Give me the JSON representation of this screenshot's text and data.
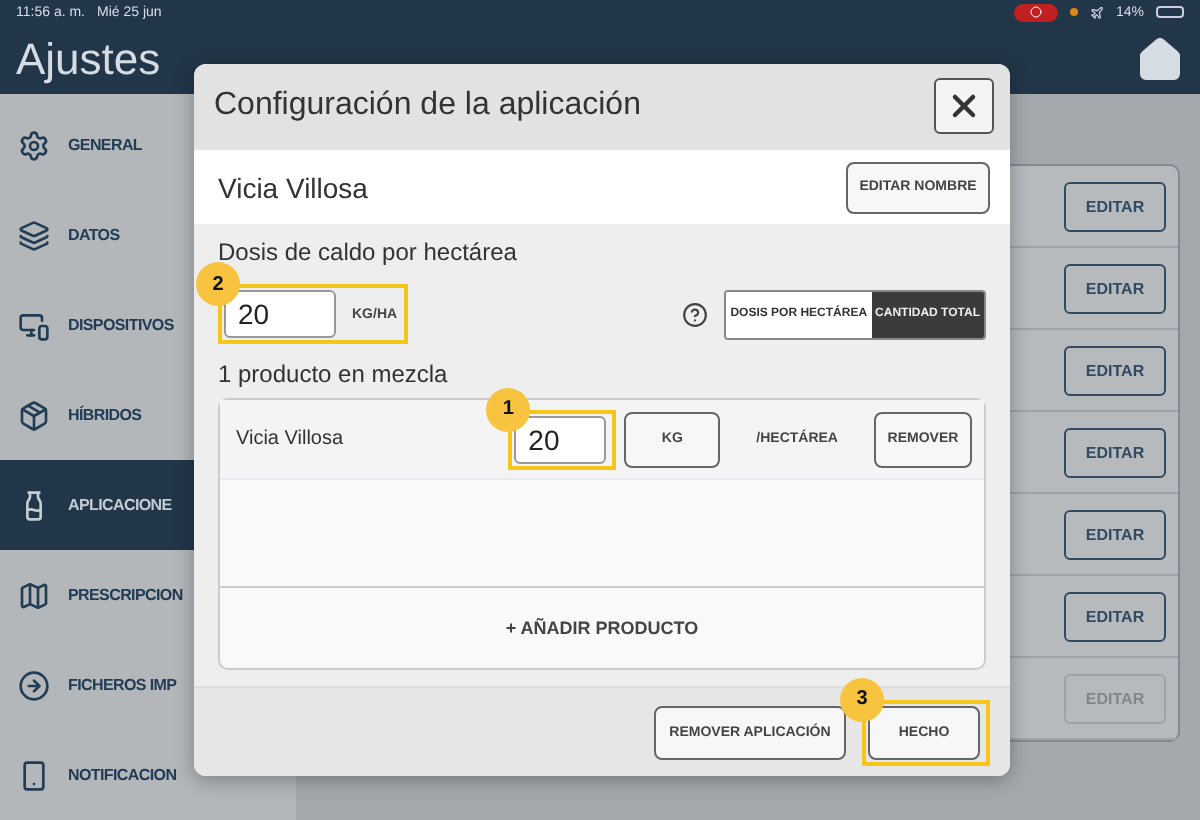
{
  "status_bar": {
    "time": "11:56 a. m.",
    "date": "Mié 25 jun",
    "battery": "14%"
  },
  "header": {
    "title": "Ajustes"
  },
  "sidebar": {
    "items": [
      {
        "label": "GENERAL",
        "selected": false
      },
      {
        "label": "DATOS",
        "selected": false
      },
      {
        "label": "DISPOSITIVOS",
        "selected": false
      },
      {
        "label": "HÍBRIDOS",
        "selected": false
      },
      {
        "label": "APLICACIONE",
        "selected": true
      },
      {
        "label": "PRESCRIPCION",
        "selected": false
      },
      {
        "label": "FICHEROS IMP",
        "selected": false
      },
      {
        "label": "NOTIFICACION",
        "selected": false
      }
    ]
  },
  "list": {
    "rows": [
      {
        "button": "EDITAR",
        "disabled": false
      },
      {
        "button": "EDITAR",
        "disabled": false
      },
      {
        "button": "EDITAR",
        "disabled": false
      },
      {
        "button": "EDITAR",
        "disabled": false
      },
      {
        "button": "EDITAR",
        "disabled": false
      },
      {
        "button": "EDITAR",
        "disabled": false
      },
      {
        "button": "EDITAR",
        "disabled": true
      }
    ]
  },
  "modal": {
    "title": "Configuración de la aplicación",
    "name": "Vicia Villosa",
    "rename_button": "EDITAR NOMBRE",
    "dose_label": "Dosis de caldo por hectárea",
    "dose_value": "20",
    "dose_unit": "KG/HA",
    "dose_callout": "2",
    "mode_options": [
      {
        "label": "DOSIS POR HECTÁREA",
        "selected": false
      },
      {
        "label": "CANTIDAD TOTAL",
        "selected": true
      }
    ],
    "products_label": "1 producto en mezcla",
    "products": [
      {
        "name": "Vicia Villosa",
        "amount": "20",
        "unit": "KG",
        "per": "/HECTÁREA",
        "remove": "REMOVER",
        "callout": "1"
      }
    ],
    "add_product": "+ AÑADIR PRODUCTO",
    "footer_buttons": [
      {
        "label": "REMOVER APLICACIÓN"
      },
      {
        "label": "HECHO",
        "callout": "3"
      }
    ]
  }
}
